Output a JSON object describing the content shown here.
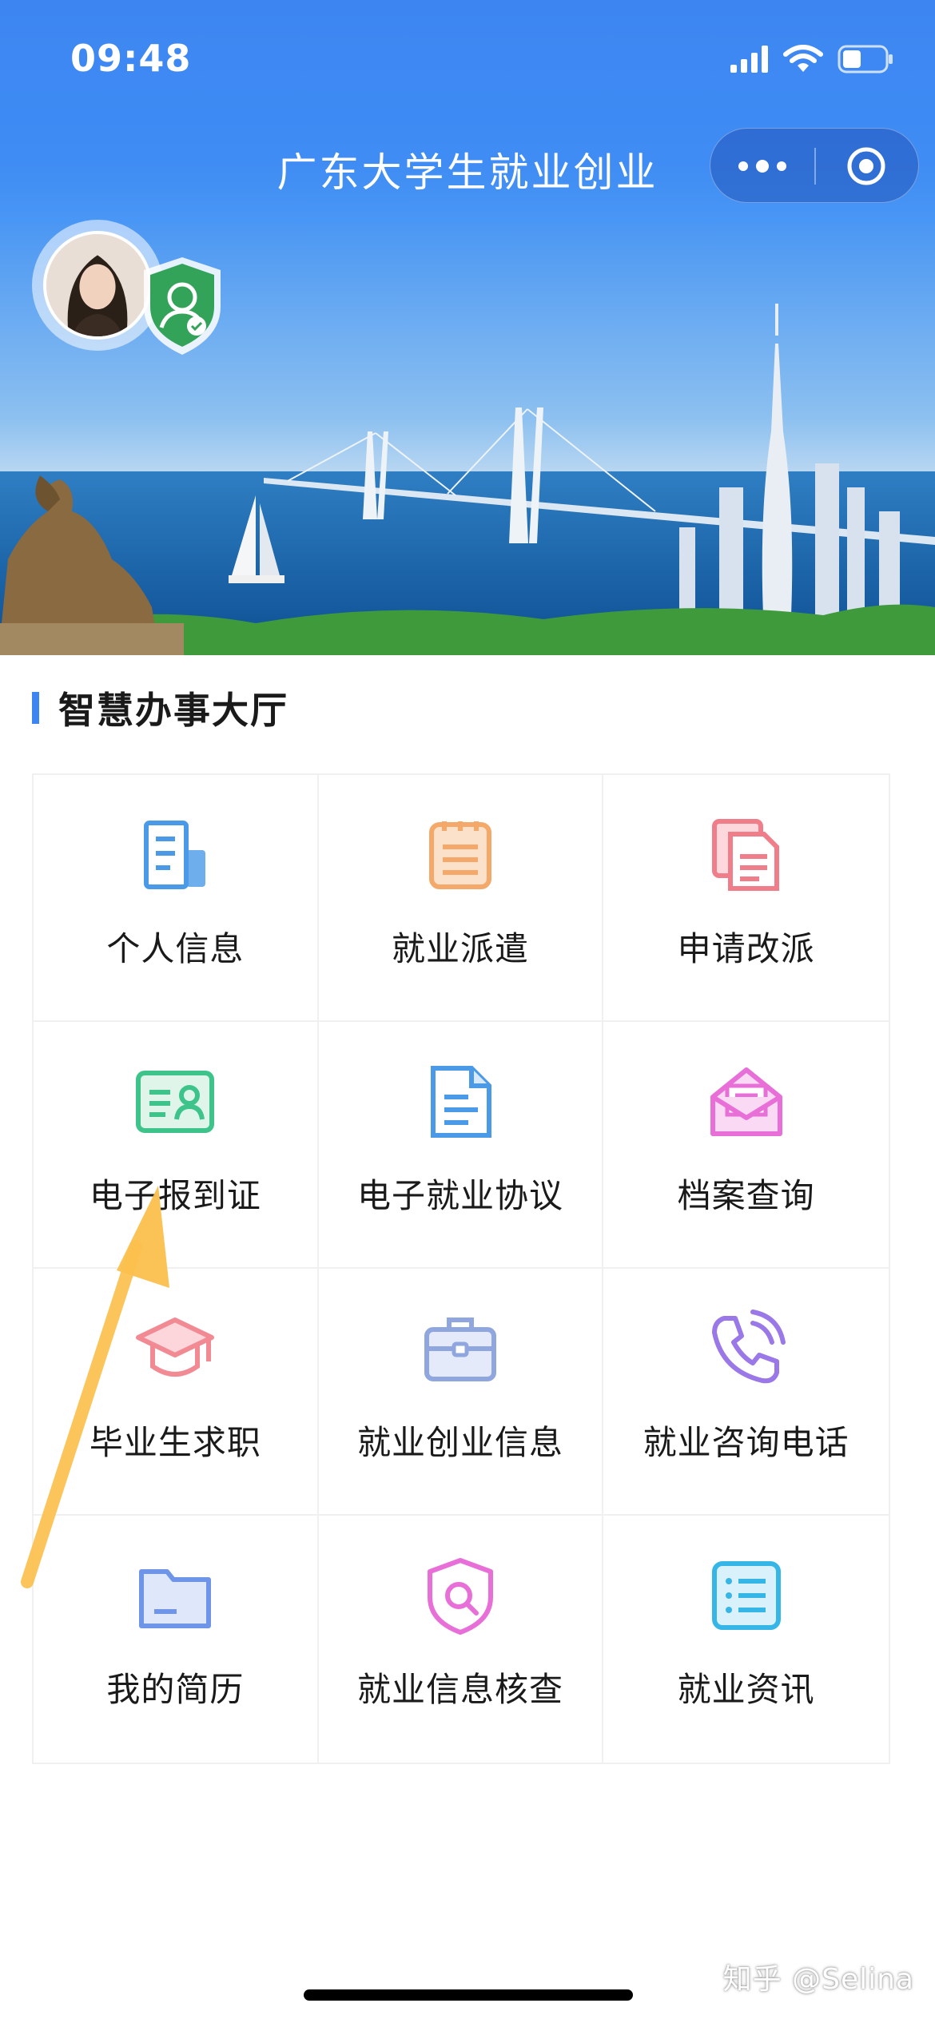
{
  "status_bar": {
    "time": "09:48"
  },
  "header": {
    "title": "广东大学生就业创业"
  },
  "section": {
    "title": "智慧办事大厅"
  },
  "services": [
    {
      "label": "个人信息",
      "icon": "profile-doc-icon",
      "color": "#4a9ae8"
    },
    {
      "label": "就业派遣",
      "icon": "notepad-icon",
      "color": "#f4a96a"
    },
    {
      "label": "申请改派",
      "icon": "documents-icon",
      "color": "#f07e8a"
    },
    {
      "label": "电子报到证",
      "icon": "id-card-icon",
      "color": "#3ec48b"
    },
    {
      "label": "电子就业协议",
      "icon": "document-icon",
      "color": "#4a9ae8"
    },
    {
      "label": "档案查询",
      "icon": "mail-open-icon",
      "color": "#e86fd8"
    },
    {
      "label": "毕业生求职",
      "icon": "graduation-cap-icon",
      "color": "#f28a94"
    },
    {
      "label": "就业创业信息",
      "icon": "briefcase-icon",
      "color": "#8fa6de"
    },
    {
      "label": "就业咨询电话",
      "icon": "phone-icon",
      "color": "#9a78e8"
    },
    {
      "label": "我的简历",
      "icon": "folder-icon",
      "color": "#6f95e8"
    },
    {
      "label": "就业信息核查",
      "icon": "shield-search-icon",
      "color": "#e86fd8"
    },
    {
      "label": "就业资讯",
      "icon": "list-icon",
      "color": "#35b6e6"
    }
  ],
  "watermark": "知乎 @Selina"
}
